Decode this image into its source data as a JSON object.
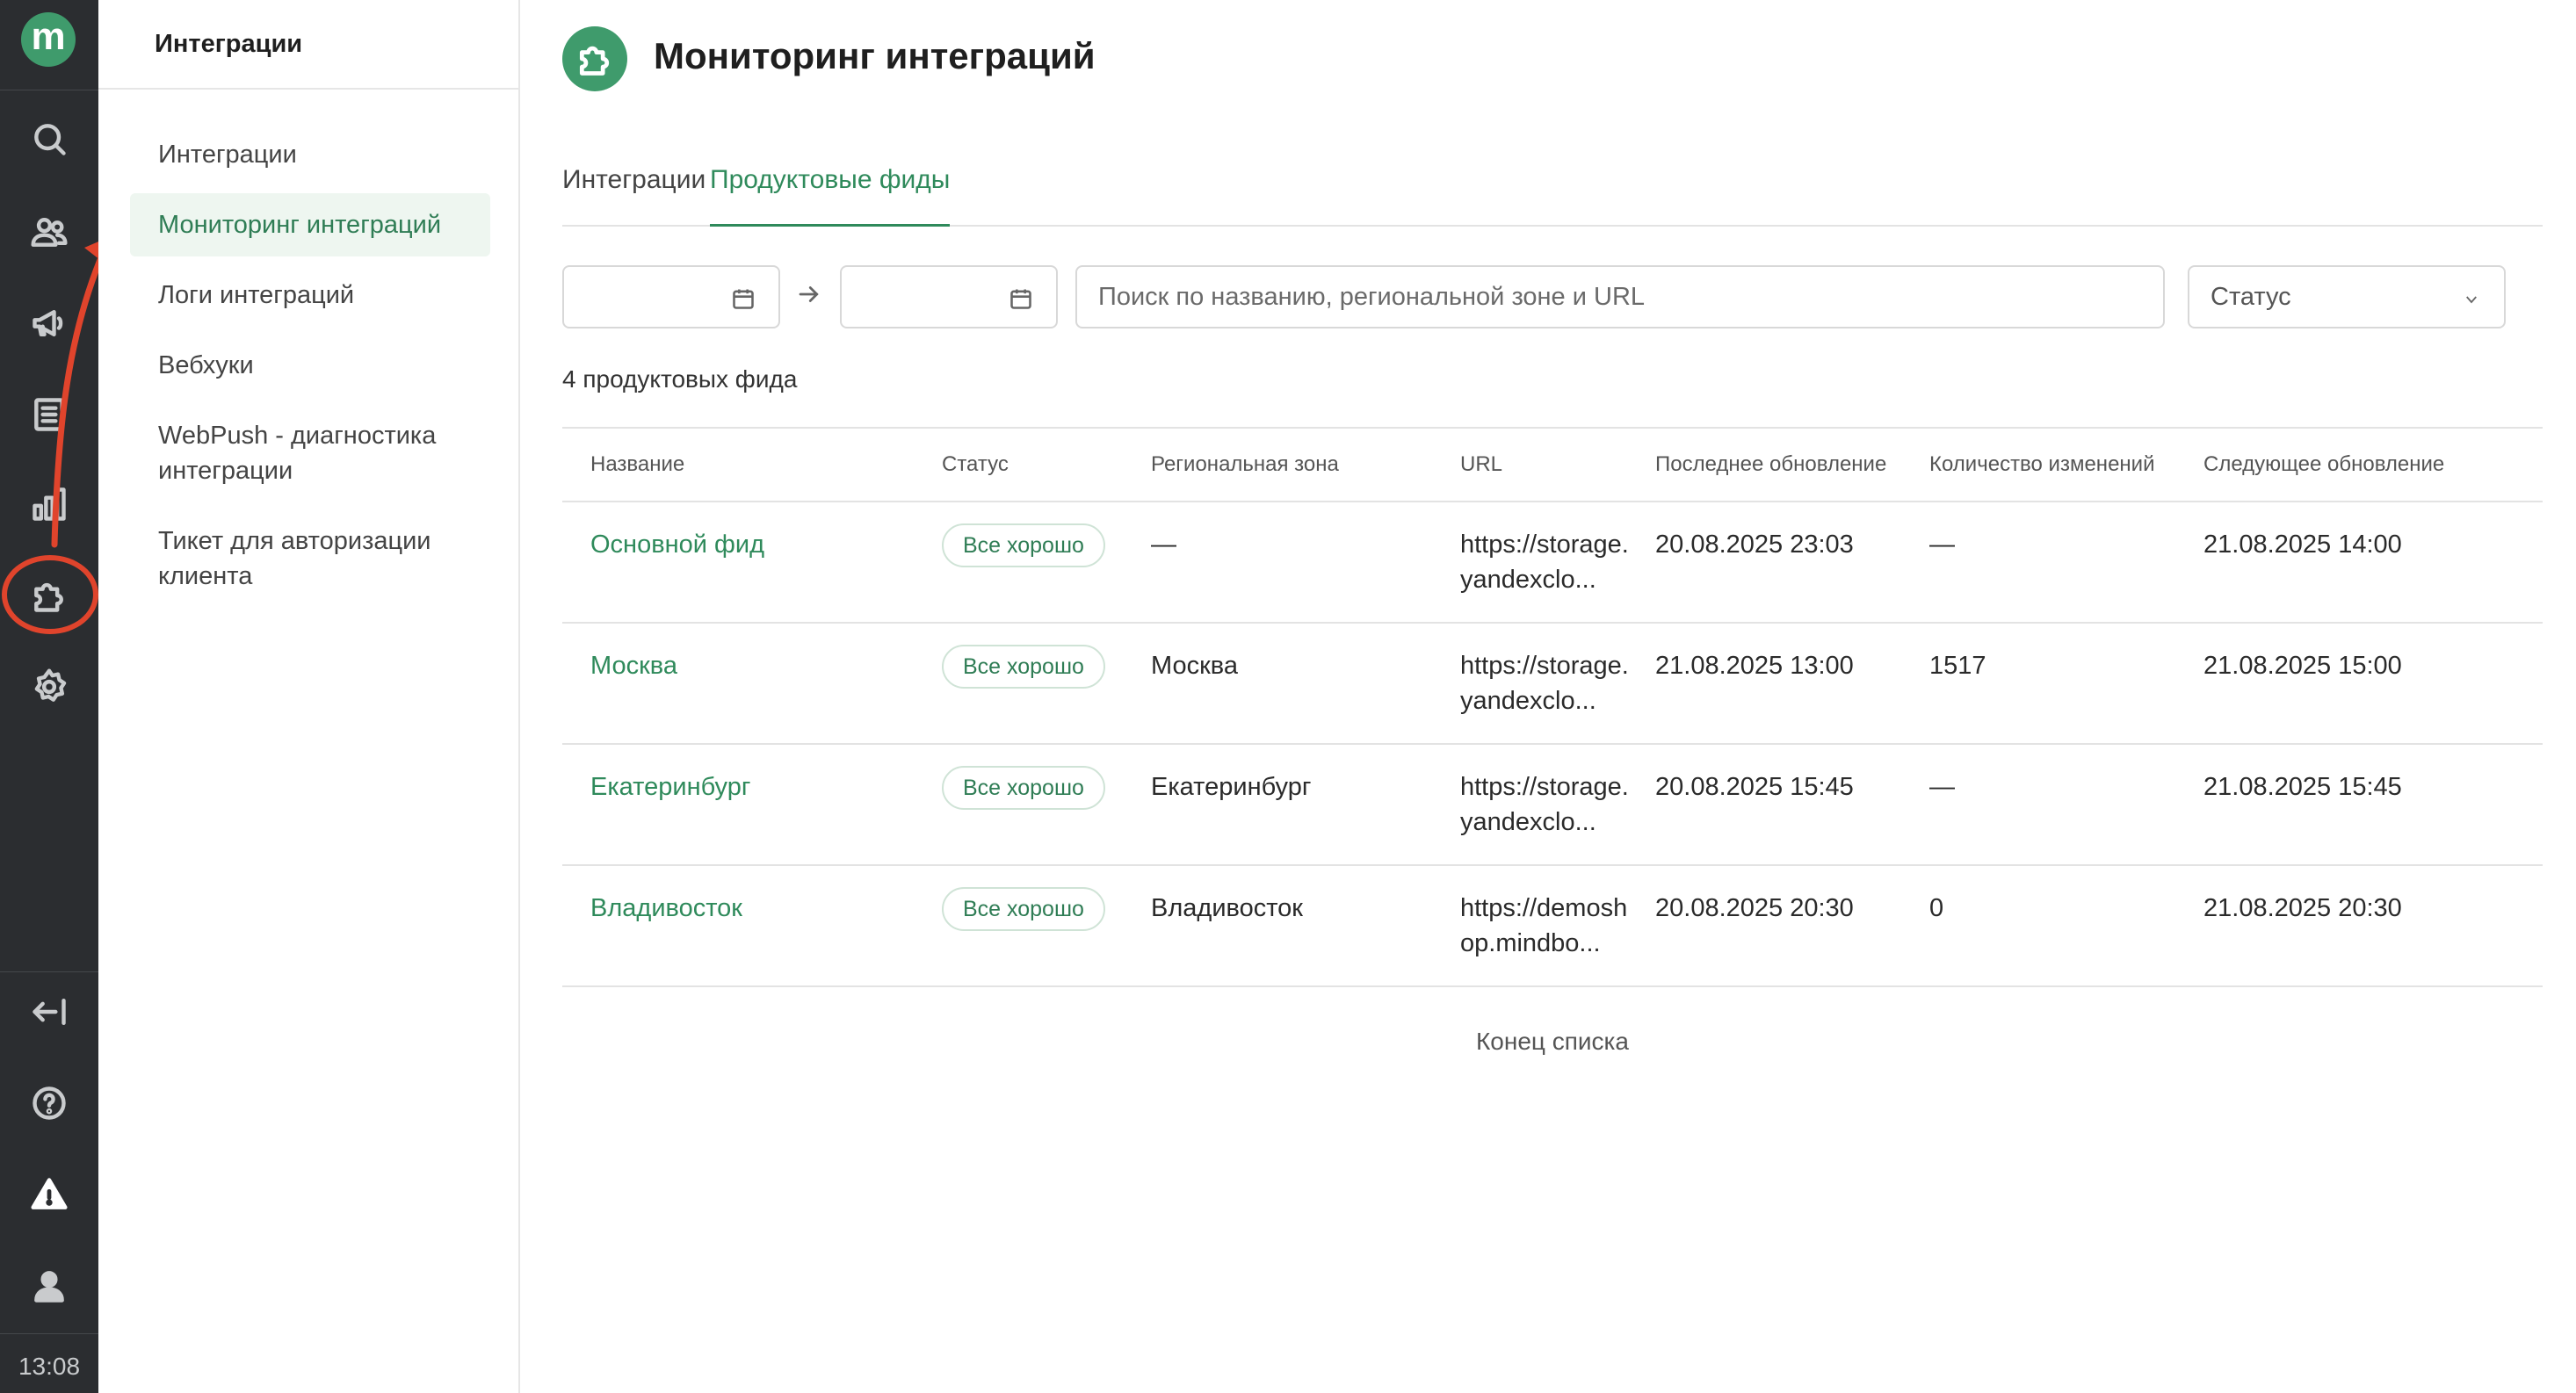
{
  "rail": {
    "logo_letter": "m",
    "time": "13:08",
    "icons": [
      "search-icon",
      "users-icon",
      "megaphone-icon",
      "list-icon",
      "chart-icon",
      "puzzle-icon",
      "gear-icon",
      "collapse-icon",
      "help-icon",
      "warning-icon",
      "user-icon"
    ]
  },
  "sidebar": {
    "title": "Интеграции",
    "items": [
      {
        "label": "Интеграции"
      },
      {
        "label": "Мониторинг интеграций"
      },
      {
        "label": "Логи интеграций"
      },
      {
        "label": "Вебхуки"
      },
      {
        "label": "WebPush - диагностика интеграции"
      },
      {
        "label": "Тикет для авторизации клиента"
      }
    ]
  },
  "page": {
    "title": "Мониторинг интеграций",
    "tabs": [
      {
        "label": "Интеграции"
      },
      {
        "label": "Продуктовые фиды"
      }
    ]
  },
  "filters": {
    "date_from": "",
    "date_to": "",
    "search_placeholder": "Поиск по названию, региональной зоне и URL",
    "search_value": "",
    "status_label": "Статус"
  },
  "count_text": "4 продуктовых фида",
  "table": {
    "headers": {
      "name": "Название",
      "status": "Статус",
      "zone": "Региональная зона",
      "url": "URL",
      "last": "Последнее обновление",
      "changes": "Количество изменений",
      "next": "Следующее обновление"
    },
    "rows": [
      {
        "name": "Основной фид",
        "status": "Все хорошо",
        "zone": "—",
        "url": "https://storage.yandexclo...",
        "last": "20.08.2025 23:03",
        "changes": "—",
        "next": "21.08.2025 14:00"
      },
      {
        "name": "Москва",
        "status": "Все хорошо",
        "zone": "Москва",
        "url": "https://storage.yandexclo...",
        "last": "21.08.2025 13:00",
        "changes": "1517",
        "next": "21.08.2025 15:00"
      },
      {
        "name": "Екатеринбург",
        "status": "Все хорошо",
        "zone": "Екатеринбург",
        "url": "https://storage.yandexclo...",
        "last": "20.08.2025 15:45",
        "changes": "—",
        "next": "21.08.2025 15:45"
      },
      {
        "name": "Владивосток",
        "status": "Все хорошо",
        "zone": "Владивосток",
        "url": "https://demoshop.mindbo...",
        "last": "20.08.2025 20:30",
        "changes": "0",
        "next": "21.08.2025 20:30"
      }
    ]
  },
  "end_text": "Конец списка",
  "colors": {
    "accent": "#2f8a5b",
    "rail_bg": "#2b2d30",
    "annotation": "#e0442c"
  }
}
